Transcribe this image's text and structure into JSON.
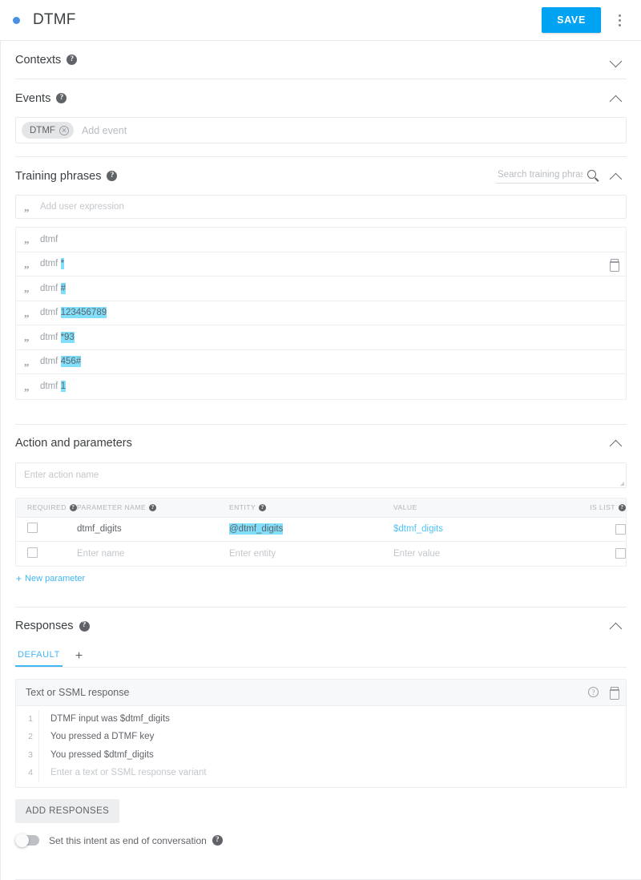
{
  "header": {
    "status_dot_color": "#4a90e2",
    "title": "DTMF",
    "save_label": "SAVE",
    "menu_icon": "more-vert-icon"
  },
  "accent_color": "#00a2f2",
  "highlight_color": "#81dffb",
  "sections": {
    "contexts": {
      "title": "Contexts",
      "help": "?",
      "expanded": false,
      "chevron": "chevron-down"
    },
    "events": {
      "title": "Events",
      "help": "?",
      "expanded": true,
      "chevron": "chevron-up",
      "chips": [
        {
          "label": "DTMF"
        }
      ],
      "placeholder": "Add event"
    },
    "training_phrases": {
      "title": "Training phrases",
      "help": "?",
      "expanded": true,
      "chevron": "chevron-up",
      "search_placeholder": "Search training phrases",
      "search_value": "",
      "add_placeholder": "Add user expression",
      "rows": [
        {
          "prefix": "dtmf",
          "highlight": "",
          "hovered": false
        },
        {
          "prefix": "dtmf ",
          "highlight": "*",
          "hovered": true
        },
        {
          "prefix": "dtmf ",
          "highlight": "#",
          "hovered": false
        },
        {
          "prefix": "dtmf ",
          "highlight": "123456789",
          "hovered": false
        },
        {
          "prefix": "dtmf ",
          "highlight": "*93",
          "hovered": false
        },
        {
          "prefix": "dtmf ",
          "highlight": "456#",
          "hovered": false
        },
        {
          "prefix": "dtmf ",
          "highlight": "1",
          "hovered": false
        }
      ]
    },
    "action_and_parameters": {
      "title": "Action and parameters",
      "expanded": true,
      "chevron": "chevron-up",
      "action_placeholder": "Enter action name",
      "action_value": "",
      "columns": [
        {
          "label": "REQUIRED",
          "help": "?"
        },
        {
          "label": "PARAMETER NAME",
          "help": "?"
        },
        {
          "label": "ENTITY",
          "help": "?"
        },
        {
          "label": "VALUE",
          "help": ""
        },
        {
          "label": "IS LIST",
          "help": "?"
        }
      ],
      "rows": [
        {
          "required": false,
          "name": "dtmf_digits",
          "name_is_placeholder": false,
          "entity": "@dtmf_digits",
          "entity_is_placeholder": false,
          "entity_highlighted": true,
          "value": "$dtmf_digits",
          "value_is_placeholder": false,
          "is_list": false
        },
        {
          "required": false,
          "name": "Enter name",
          "name_is_placeholder": true,
          "entity": "Enter entity",
          "entity_is_placeholder": true,
          "entity_highlighted": false,
          "value": "Enter value",
          "value_is_placeholder": true,
          "is_list": false
        }
      ],
      "new_parameter_label": "New parameter",
      "new_parameter_plus": "+"
    },
    "responses": {
      "title": "Responses",
      "help": "?",
      "expanded": true,
      "chevron": "chevron-up",
      "tabs": [
        {
          "label": "DEFAULT",
          "active": true
        }
      ],
      "add_tab_icon": "plus-icon",
      "card": {
        "title": "Text or SSML response",
        "help_icon": "help-circle-icon",
        "delete_icon": "trash-icon",
        "variants": [
          {
            "num": "1",
            "text": "DTMF input was $dtmf_digits",
            "placeholder": false
          },
          {
            "num": "2",
            "text": "You pressed a DTMF key",
            "placeholder": false
          },
          {
            "num": "3",
            "text": "You pressed $dtmf_digits",
            "placeholder": false
          },
          {
            "num": "4",
            "text": "Enter a text or SSML response variant",
            "placeholder": true
          }
        ]
      },
      "add_responses_label": "ADD RESPONSES",
      "end_of_conversation": {
        "label": "Set this intent as end of conversation",
        "help": "?",
        "enabled": false
      }
    }
  }
}
